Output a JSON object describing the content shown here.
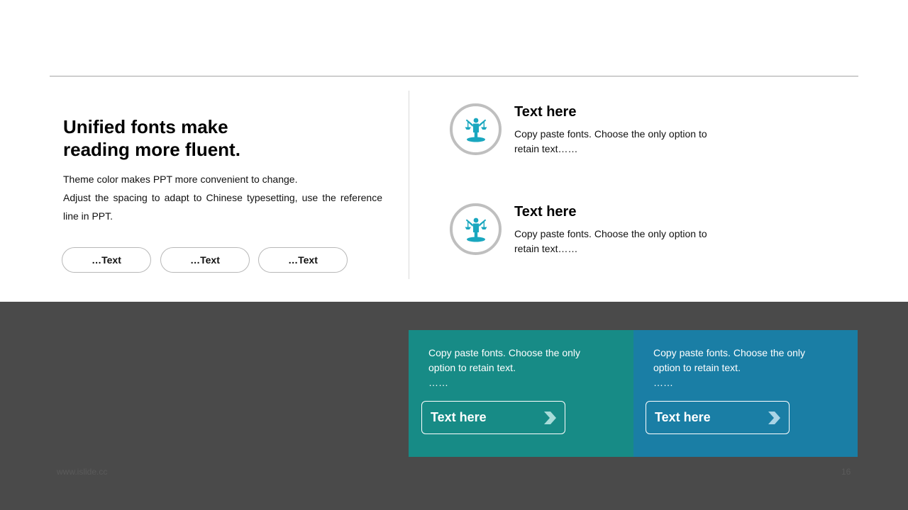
{
  "left": {
    "heading_line1": "Unified fonts make",
    "heading_line2": "reading more fluent.",
    "paragraph_line1": "Theme color makes PPT more convenient  to change.",
    "paragraph_line2": "Adjust the spacing to adapt to Chinese  typesetting,  use the reference line  in  PPT.",
    "pills": [
      "…Text",
      "…Text",
      "…Text"
    ]
  },
  "features": [
    {
      "icon": "justice-figure-icon",
      "title": "Text here",
      "desc_line1": "Copy paste fonts. Choose the only option to",
      "desc_line2": "retain text……"
    },
    {
      "icon": "justice-figure-icon",
      "title": "Text here",
      "desc_line1": "Copy paste fonts. Choose the only option to",
      "desc_line2": "retain text……"
    }
  ],
  "panels": [
    {
      "line1": "Copy paste fonts. Choose the only",
      "line2": "option to retain text.",
      "line3": "……",
      "button": "Text here",
      "color": "#178b86"
    },
    {
      "line1": "Copy paste fonts. Choose the only",
      "line2": "option to retain text.",
      "line3": "……",
      "button": "Text here",
      "color": "#1a7ea5"
    }
  ],
  "footer": {
    "left": "www.islide.cc",
    "right": "16"
  },
  "colors": {
    "accent_teal": "#178b86",
    "accent_blue": "#1a7ea5",
    "icon_cyan": "#1aa7bf",
    "dark_band": "#4a4a4a"
  }
}
